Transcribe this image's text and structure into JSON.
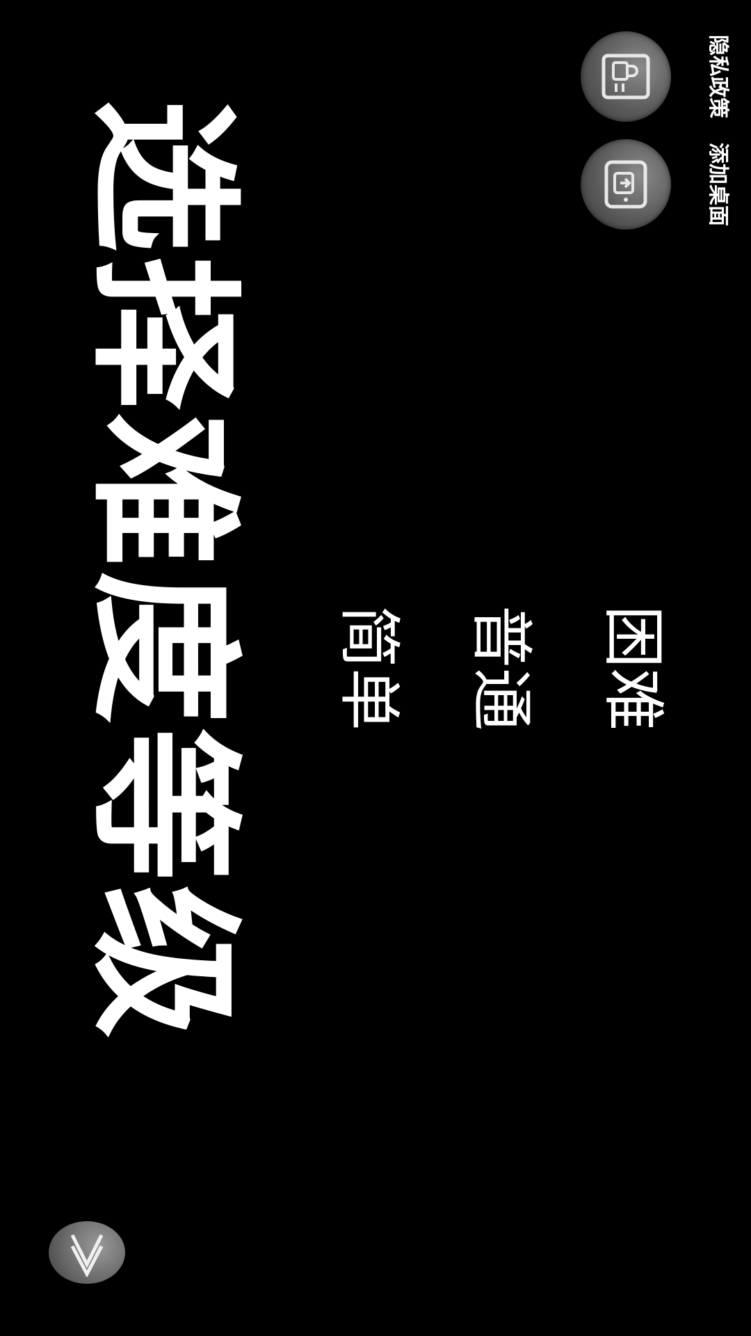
{
  "screen": {
    "title": "选择难度等级",
    "orientation": "rotated-90"
  },
  "difficulty": {
    "easy_label": "简单",
    "normal_label": "普通",
    "hard_label": "困难"
  },
  "corner_buttons": {
    "privacy_label": "隐私政策",
    "privacy_icon": "lock-document-icon",
    "desktop_label": "添加桌面",
    "desktop_icon": "add-to-desktop-icon"
  },
  "collapse": {
    "icon": "double-chevron-icon"
  },
  "colors": {
    "background": "#000000",
    "text": "#ffffff",
    "button_gray": "#6a6a6a"
  }
}
